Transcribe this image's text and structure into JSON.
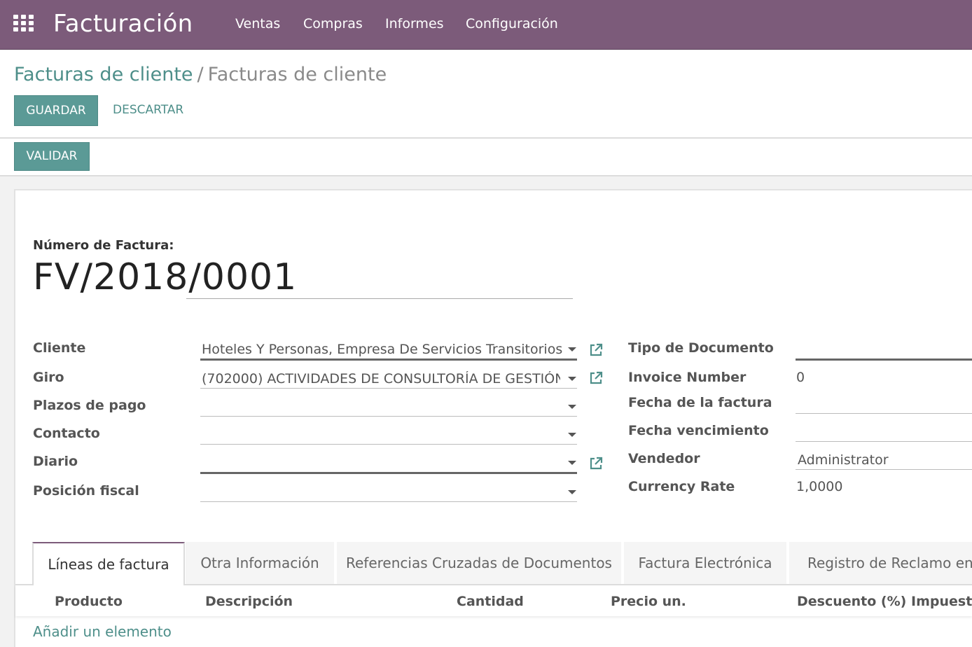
{
  "navbar": {
    "apps_icon": "grid-icon",
    "brand": "Facturación",
    "menu": [
      "Ventas",
      "Compras",
      "Informes",
      "Configuración"
    ]
  },
  "breadcrumb": {
    "parent": "Facturas de cliente",
    "separator": "/",
    "current": "Facturas de cliente"
  },
  "buttons": {
    "save": "GUARDAR",
    "discard": "DESCARTAR",
    "validate": "VALIDAR"
  },
  "invoice": {
    "number_label": "Número de Factura:",
    "number": "FV/2018/0001"
  },
  "left_fields": {
    "cliente": {
      "label": "Cliente",
      "value": "Hoteles Y Personas, Empresa De Servicios Transitorios"
    },
    "giro": {
      "label": "Giro",
      "value": "(702000) ACTIVIDADES DE CONSULTORÍA DE GESTIÓN"
    },
    "plazos": {
      "label": "Plazos de pago",
      "value": ""
    },
    "contacto": {
      "label": "Contacto",
      "value": ""
    },
    "diario": {
      "label": "Diario",
      "value": ""
    },
    "posicion": {
      "label": "Posición fiscal",
      "value": ""
    }
  },
  "right_fields": {
    "tipo": {
      "label": "Tipo de Documento",
      "value": ""
    },
    "invoice_number": {
      "label": "Invoice Number",
      "value": "0"
    },
    "fecha_factura": {
      "label": "Fecha de la factura",
      "value": ""
    },
    "fecha_venc": {
      "label": "Fecha vencimiento",
      "value": ""
    },
    "vendedor": {
      "label": "Vendedor",
      "value": "Administrator"
    },
    "currency_rate": {
      "label": "Currency Rate",
      "value": "1,0000"
    }
  },
  "tabs": [
    "Líneas de factura",
    "Otra Información",
    "Referencias Cruzadas de Documentos",
    "Factura Electrónica",
    "Registro de Reclamo en SII"
  ],
  "table": {
    "columns": [
      "Producto",
      "Descripción",
      "Cantidad",
      "Precio un.",
      "Descuento (%)",
      "Impuestos"
    ],
    "add_item": "Añadir un elemento"
  },
  "colors": {
    "navbar": "#7c5b7a",
    "primary": "#5b9a96",
    "link": "#4e8f8a"
  }
}
